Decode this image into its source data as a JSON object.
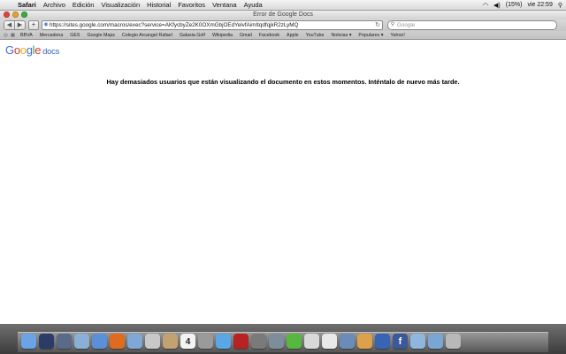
{
  "menubar": {
    "app": "Safari",
    "items": [
      "Archivo",
      "Edición",
      "Visualización",
      "Historial",
      "Favoritos",
      "Ventana",
      "Ayuda"
    ],
    "battery": "(15%)",
    "time": "vie 22:59"
  },
  "window": {
    "title": "Error de Google Docs",
    "url": "https://sites.google.com/macros/exec?service=AKfycbyZe2K0OXmGbjOEdYelvfAimItqdfqjkR2zLyMQ",
    "search_placeholder": "Google"
  },
  "bookmarks": [
    "BBVA",
    "Mercadona",
    "GES",
    "Google Maps",
    "Colegio Arcangel Rafael",
    "Galaxia Golf",
    "Wikipedia",
    "Gmail",
    "Facebook",
    "Apple",
    "YouTube",
    "Noticias ▾",
    "Populares ▾",
    "Yahoo!"
  ],
  "page": {
    "logo_google": "Google",
    "logo_docs": "docs",
    "message": "Hay demasiados usuarios que están visualizando el documento en estos momentos. Inténtalo de nuevo más tarde."
  },
  "dock": {
    "icons": [
      "finder-icon",
      "dashboard-icon",
      "mission-control-icon",
      "preview-icon",
      "safari-icon",
      "firefox-icon",
      "chat-icon",
      "mail-icon",
      "address-book-icon",
      "calendar-icon",
      "photo-icon",
      "itunes-icon",
      "photobooth-icon",
      "time-machine-icon",
      "system-preferences-icon",
      "spotify-icon",
      "app-icon",
      "app-icon",
      "app-icon",
      "app-icon",
      "app-icon",
      "facebook-icon",
      "folder-icon",
      "downloads-icon",
      "trash-icon"
    ],
    "colors": [
      "#6aa4e6",
      "#2b3d66",
      "#5a6b8a",
      "#8ab0d8",
      "#5b90d8",
      "#e06b1f",
      "#7fa8d6",
      "#c8c8c8",
      "#c3a272",
      "#f3f3f3",
      "#9a9a9a",
      "#59a7e6",
      "#b72222",
      "#7a7a7a",
      "#7d8d9c",
      "#57b83f",
      "#d9d9d9",
      "#e9e9e9",
      "#6b8bb8",
      "#dca14a",
      "#3765b3",
      "#3b5998",
      "#8fb6dc",
      "#7aa6d4",
      "#b8b8b8"
    ]
  },
  "calendar_day": "4"
}
